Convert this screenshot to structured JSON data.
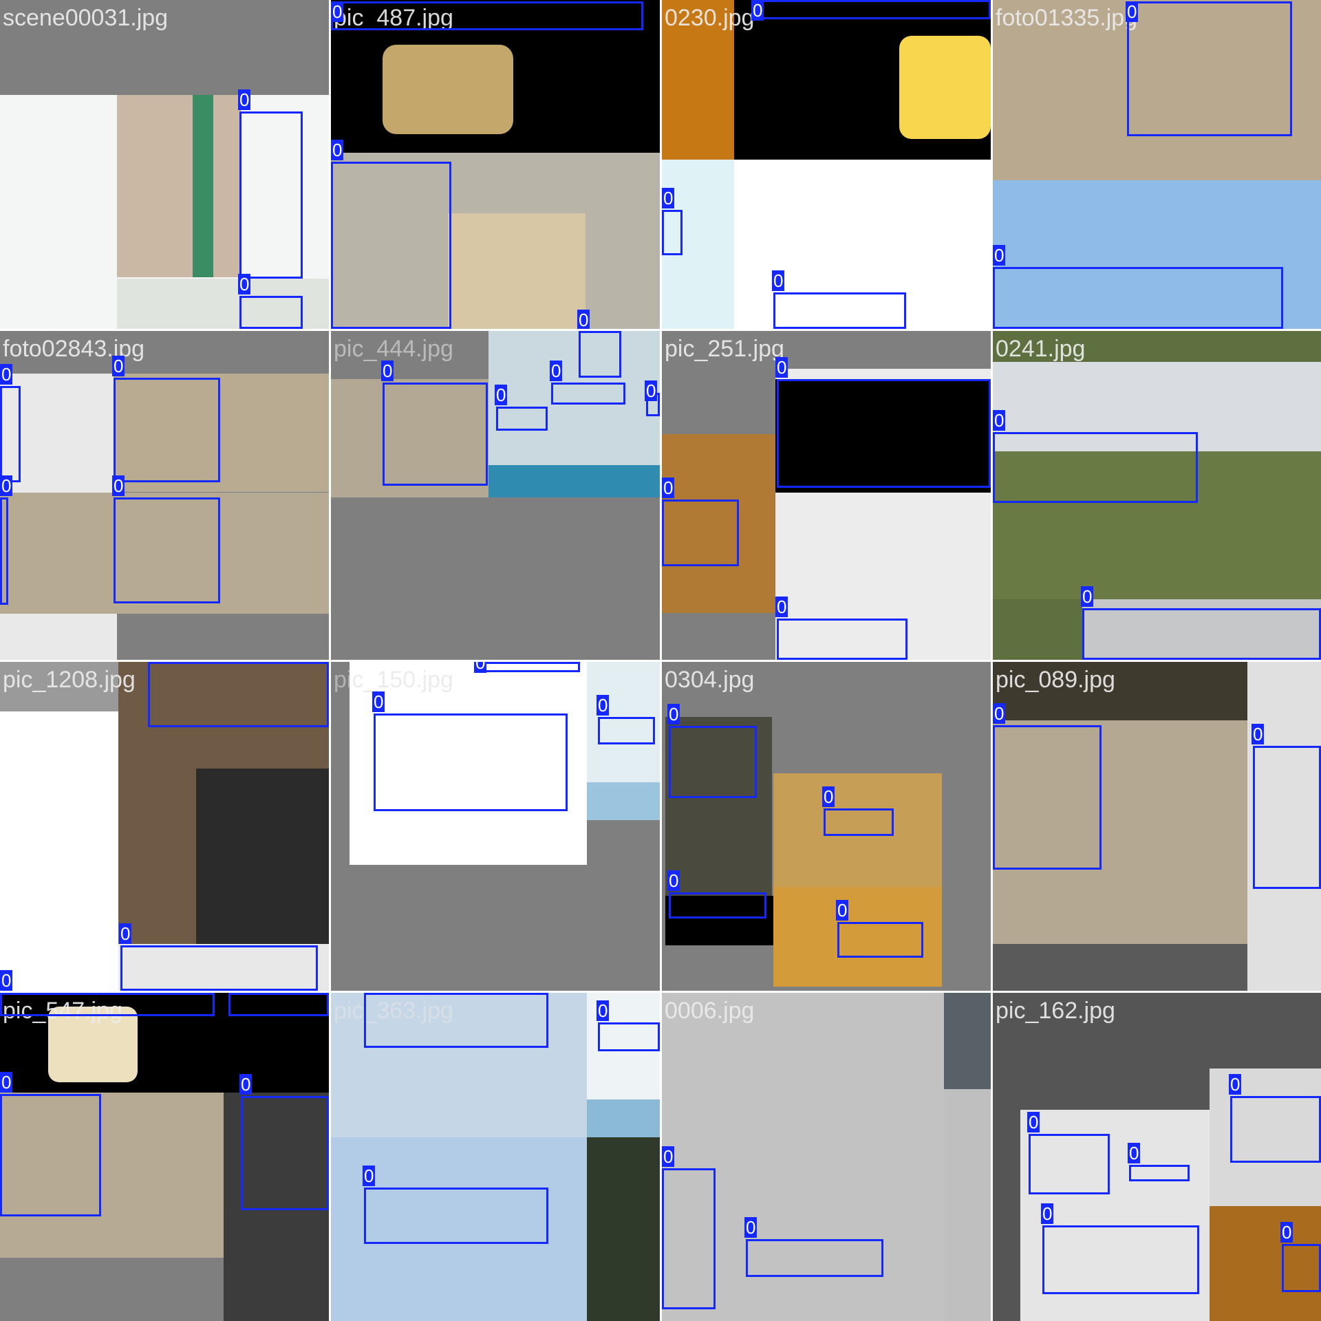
{
  "tiles": [
    {
      "name": "scene00031.jpg",
      "labels": [
        "0",
        "0"
      ]
    },
    {
      "name": "pic_487.jpg",
      "labels": [
        "0",
        "0",
        "0"
      ]
    },
    {
      "name": "0230.jpg",
      "labels": [
        "0",
        "0",
        "0"
      ]
    },
    {
      "name": "foto01335.jpg",
      "labels": [
        "0",
        "0"
      ]
    },
    {
      "name": "foto02843.jpg",
      "labels": [
        "0",
        "0",
        "0",
        "0"
      ]
    },
    {
      "name": "pic_444.jpg",
      "labels": [
        "0",
        "0",
        "0",
        "0",
        "0"
      ]
    },
    {
      "name": "pic_251.jpg",
      "labels": [
        "0",
        "0",
        "0"
      ]
    },
    {
      "name": "0241.jpg",
      "labels": [
        "0",
        "0"
      ]
    },
    {
      "name": "pic_1208.jpg",
      "labels": [
        "0",
        "0",
        "0"
      ]
    },
    {
      "name": "pic_150.jpg",
      "labels": [
        "0",
        "0",
        "0"
      ]
    },
    {
      "name": "0304.jpg",
      "labels": [
        "0",
        "0",
        "0",
        "0"
      ]
    },
    {
      "name": "pic_089.jpg",
      "labels": [
        "0",
        "0"
      ]
    },
    {
      "name": "pic_547.jpg",
      "labels": [
        "0",
        "0",
        "0",
        "0"
      ]
    },
    {
      "name": "pic_363.jpg",
      "labels": [
        "0",
        "0",
        "0"
      ]
    },
    {
      "name": "0006.jpg",
      "labels": [
        "0",
        "0",
        "0"
      ]
    },
    {
      "name": "pic_162.jpg",
      "labels": [
        "0",
        "0",
        "0",
        "0",
        "0"
      ]
    }
  ],
  "box_color": "#1428ff"
}
